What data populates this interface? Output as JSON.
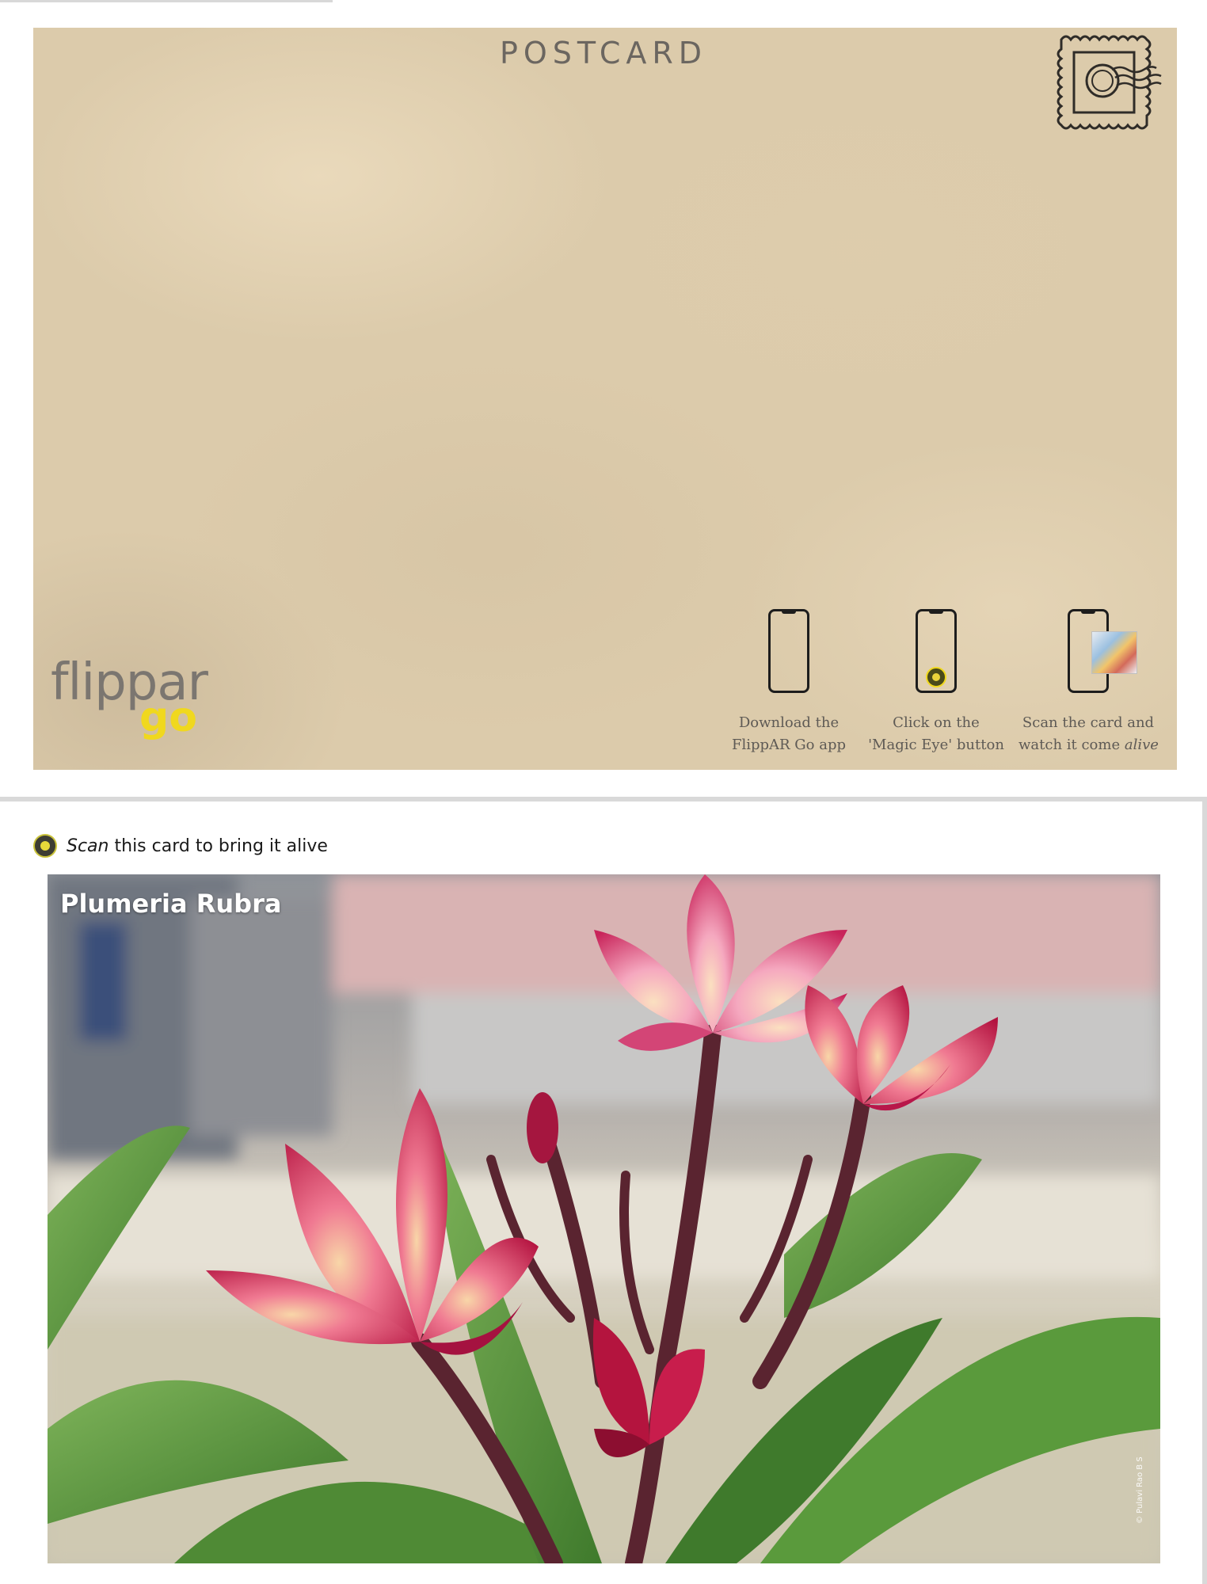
{
  "postcard": {
    "title": "POSTCARD",
    "brand": {
      "word": "flippar",
      "go": "go",
      "go_color": "#f0d81e"
    },
    "steps": [
      {
        "line1": "Download the",
        "line2": "FlippAR Go app",
        "icon": "phone-icon"
      },
      {
        "line1": "Click on the",
        "line2": "'Magic Eye' button",
        "icon": "phone-magic-eye-icon"
      },
      {
        "line1": "Scan the card and",
        "line2_prefix": "watch it come ",
        "line2_em": "alive",
        "icon": "phone-scan-card-icon"
      }
    ]
  },
  "scan_prompt": {
    "em": "Scan",
    "rest": " this card to bring it alive"
  },
  "photo": {
    "caption": "Plumeria Rubra",
    "credit": "© Pulavi Rao B S"
  }
}
